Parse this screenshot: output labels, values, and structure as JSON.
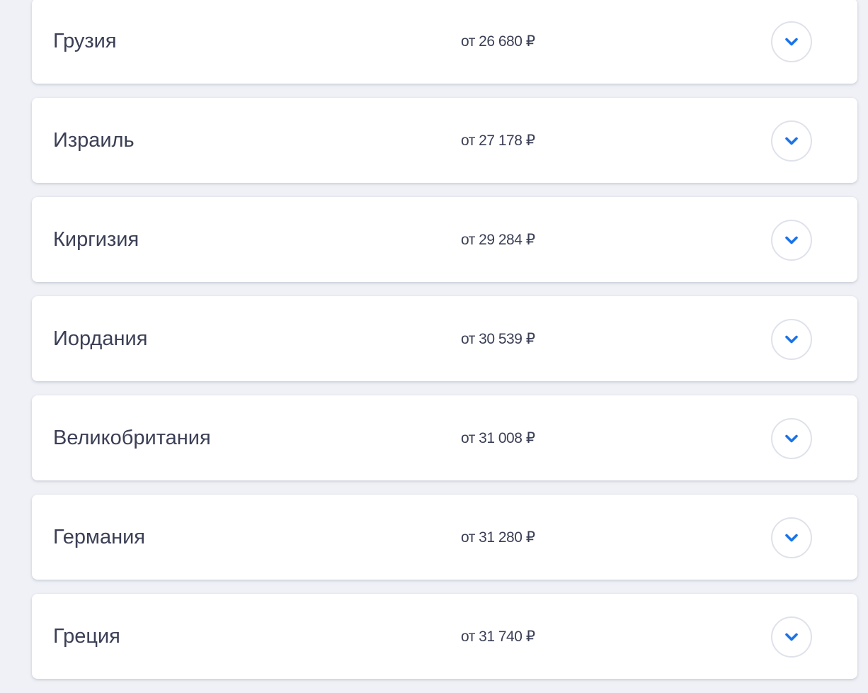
{
  "accent_color": "#1a73e8",
  "destinations": [
    {
      "country": "Грузия",
      "price": "от 26 680 ₽"
    },
    {
      "country": "Израиль",
      "price": "от 27 178 ₽"
    },
    {
      "country": "Киргизия",
      "price": "от 29 284 ₽"
    },
    {
      "country": "Иордания",
      "price": "от 30 539 ₽"
    },
    {
      "country": "Великобритания",
      "price": "от 31 008 ₽"
    },
    {
      "country": "Германия",
      "price": "от 31 280 ₽"
    },
    {
      "country": "Греция",
      "price": "от 31 740 ₽"
    }
  ],
  "expand_icon": "chevron-down-icon"
}
